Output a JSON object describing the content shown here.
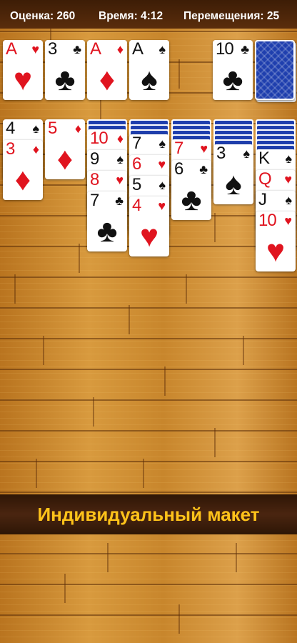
{
  "status": {
    "score_label": "Оценка: 260",
    "time_label": "Время: 4:12",
    "moves_label": "Перемещения: 25"
  },
  "colors": {
    "red_suit": "#e0141f",
    "black_suit": "#111111",
    "card_back": "#1f3fae",
    "banner_text": "#ffc31a"
  },
  "foundations": [
    {
      "rank": "A",
      "suit": "♥",
      "color": "red"
    },
    {
      "rank": "3",
      "suit": "♣",
      "color": "black"
    },
    {
      "rank": "A",
      "suit": "♦",
      "color": "red"
    },
    {
      "rank": "A",
      "suit": "♠",
      "color": "black"
    }
  ],
  "waste": {
    "rank": "10",
    "suit": "♣",
    "color": "black"
  },
  "stock": {
    "face": "down",
    "icon": "card-back-pattern"
  },
  "tableau": [
    {
      "facedown": 0,
      "cards": [
        {
          "rank": "4",
          "suit": "♠",
          "color": "black"
        },
        {
          "rank": "3",
          "suit": "♦",
          "color": "red"
        }
      ]
    },
    {
      "facedown": 0,
      "cards": [
        {
          "rank": "5",
          "suit": "♦",
          "color": "red"
        }
      ]
    },
    {
      "facedown": 2,
      "cards": [
        {
          "rank": "10",
          "suit": "♦",
          "color": "red"
        },
        {
          "rank": "9",
          "suit": "♠",
          "color": "black"
        },
        {
          "rank": "8",
          "suit": "♥",
          "color": "red"
        },
        {
          "rank": "7",
          "suit": "♣",
          "color": "black"
        }
      ]
    },
    {
      "facedown": 3,
      "cards": [
        {
          "rank": "7",
          "suit": "♠",
          "color": "black"
        },
        {
          "rank": "6",
          "suit": "♥",
          "color": "red"
        },
        {
          "rank": "5",
          "suit": "♠",
          "color": "black"
        },
        {
          "rank": "4",
          "suit": "♥",
          "color": "red"
        }
      ]
    },
    {
      "facedown": 4,
      "cards": [
        {
          "rank": "7",
          "suit": "♥",
          "color": "red"
        },
        {
          "rank": "6",
          "suit": "♣",
          "color": "black"
        }
      ]
    },
    {
      "facedown": 5,
      "cards": [
        {
          "rank": "3",
          "suit": "♠",
          "color": "black"
        }
      ]
    },
    {
      "facedown": 6,
      "cards": [
        {
          "rank": "K",
          "suit": "♠",
          "color": "black"
        },
        {
          "rank": "Q",
          "suit": "♥",
          "color": "red"
        },
        {
          "rank": "J",
          "suit": "♠",
          "color": "black"
        },
        {
          "rank": "10",
          "suit": "♥",
          "color": "red"
        }
      ]
    }
  ],
  "banner": {
    "text": "Индивидуальный макет"
  }
}
